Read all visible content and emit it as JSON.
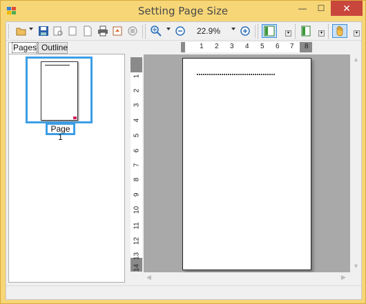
{
  "window": {
    "title": "Setting Page Size",
    "minimize_glyph": "—",
    "maximize_glyph": "☐",
    "close_glyph": "✕"
  },
  "toolbar": {
    "items": [
      "open-icon",
      "save-icon",
      "print-preview-icon",
      "single-page-icon",
      "blank-page-icon",
      "print-icon",
      "export-icon",
      "stop-icon",
      "zoom-in-icon",
      "zoom-out-icon",
      "zoom-in-plus-icon",
      "thumbnail-panel-icon",
      "page-view-icon",
      "hand-tool-icon"
    ],
    "zoom_value": "22.9%"
  },
  "tabs": {
    "pages": "Pages",
    "outline": "Outline"
  },
  "thumbnails": [
    {
      "label": "Page 1"
    }
  ],
  "ruler": {
    "horizontal": [
      "1",
      "2",
      "3",
      "4",
      "5",
      "6",
      "7",
      "8"
    ],
    "vertical": [
      "1",
      "2",
      "3",
      "4",
      "5",
      "6",
      "7",
      "8",
      "9",
      "10",
      "11",
      "12",
      "13",
      "14"
    ]
  },
  "colors": {
    "title_bar": "#f6d677",
    "close_button": "#c9463d",
    "selection": "#3b9ee6",
    "viewer_bg": "#a9a9a9"
  }
}
